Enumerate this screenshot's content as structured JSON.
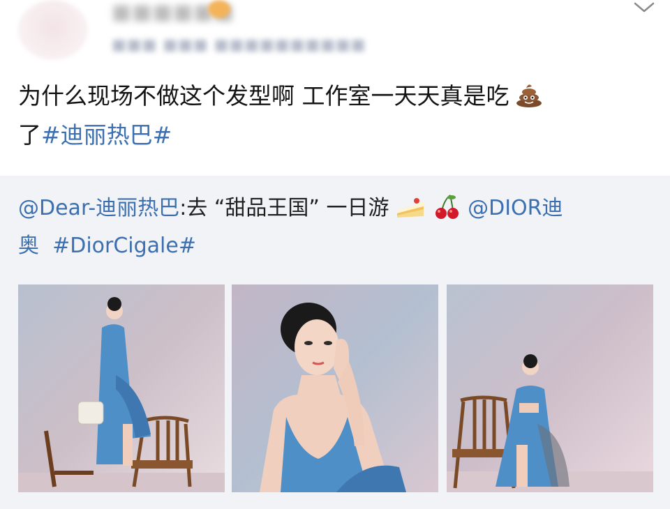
{
  "post": {
    "text_line1": "为什么现场不做这个发型啊 工作室一天天真是吃",
    "text_line2_prefix": "了",
    "hashtag": "#迪丽热巴#",
    "emoji": "poop-emoji"
  },
  "quote": {
    "mention": "@Dear-迪丽热巴",
    "text": ":去 “甜品王国” 一日游",
    "mention2": "@DIOR迪",
    "line2_prefix": "奥",
    "hashtag": "#DiorCigale#",
    "emojis": [
      "cake-emoji",
      "cherry-emoji"
    ]
  },
  "images": [
    {
      "name": "photo-standing-chair"
    },
    {
      "name": "photo-portrait"
    },
    {
      "name": "photo-seated-chair"
    }
  ],
  "colors": {
    "link": "#3c6fb0",
    "quote_background": "#f1f3f6",
    "dress_blue": "#4f8fc8"
  },
  "icons": {
    "more": "chevron-down-icon"
  }
}
